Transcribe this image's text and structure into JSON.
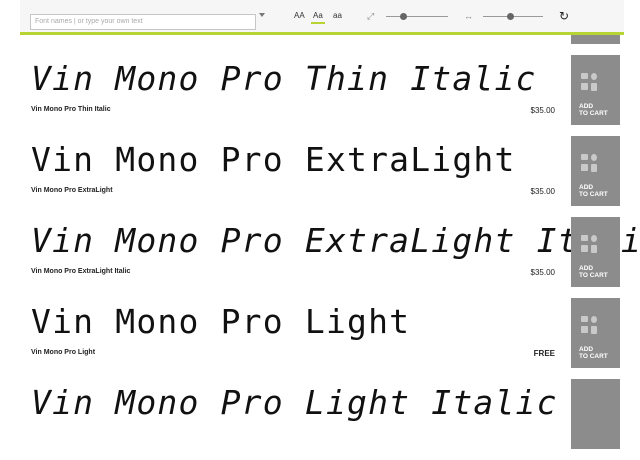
{
  "toolbar": {
    "search_placeholder": "Font names | or type your own text",
    "case_options": [
      "AA",
      "Aa",
      "aa"
    ],
    "active_case": "Aa",
    "size_slider_level": 0.28,
    "spacing_slider_level": 0.45
  },
  "top_cart": {
    "label_line1": "TO CART"
  },
  "fonts": [
    {
      "sample": "Vin Mono Pro Thin Italic",
      "name": "Vin Mono Pro Thin Italic",
      "price": "$35.00",
      "italic": true,
      "cart_line1": "ADD",
      "cart_line2": "TO CART"
    },
    {
      "sample": "Vin Mono Pro ExtraLight",
      "name": "Vin Mono Pro ExtraLight",
      "price": "$35.00",
      "italic": false,
      "cart_line1": "ADD",
      "cart_line2": "TO CART"
    },
    {
      "sample": "Vin Mono Pro ExtraLight Italic",
      "name": "Vin Mono Pro ExtraLight Italic",
      "price": "$35.00",
      "italic": true,
      "cart_line1": "ADD",
      "cart_line2": "TO CART"
    },
    {
      "sample": "Vin Mono Pro Light",
      "name": "Vin Mono Pro Light",
      "price": "FREE",
      "italic": false,
      "cart_line1": "ADD",
      "cart_line2": "TO CART"
    },
    {
      "sample": "Vin Mono Pro Light Italic",
      "italic": true
    }
  ],
  "colors": {
    "accent": "#b7d433",
    "cart_button": "#8c8c8c",
    "toolbar_bg": "#f6f6f6"
  },
  "icons": {
    "expand": "expand-icon",
    "spacing": "letter-spacing-icon",
    "reset": "reset-icon",
    "dropdown": "chevron-down-icon"
  }
}
